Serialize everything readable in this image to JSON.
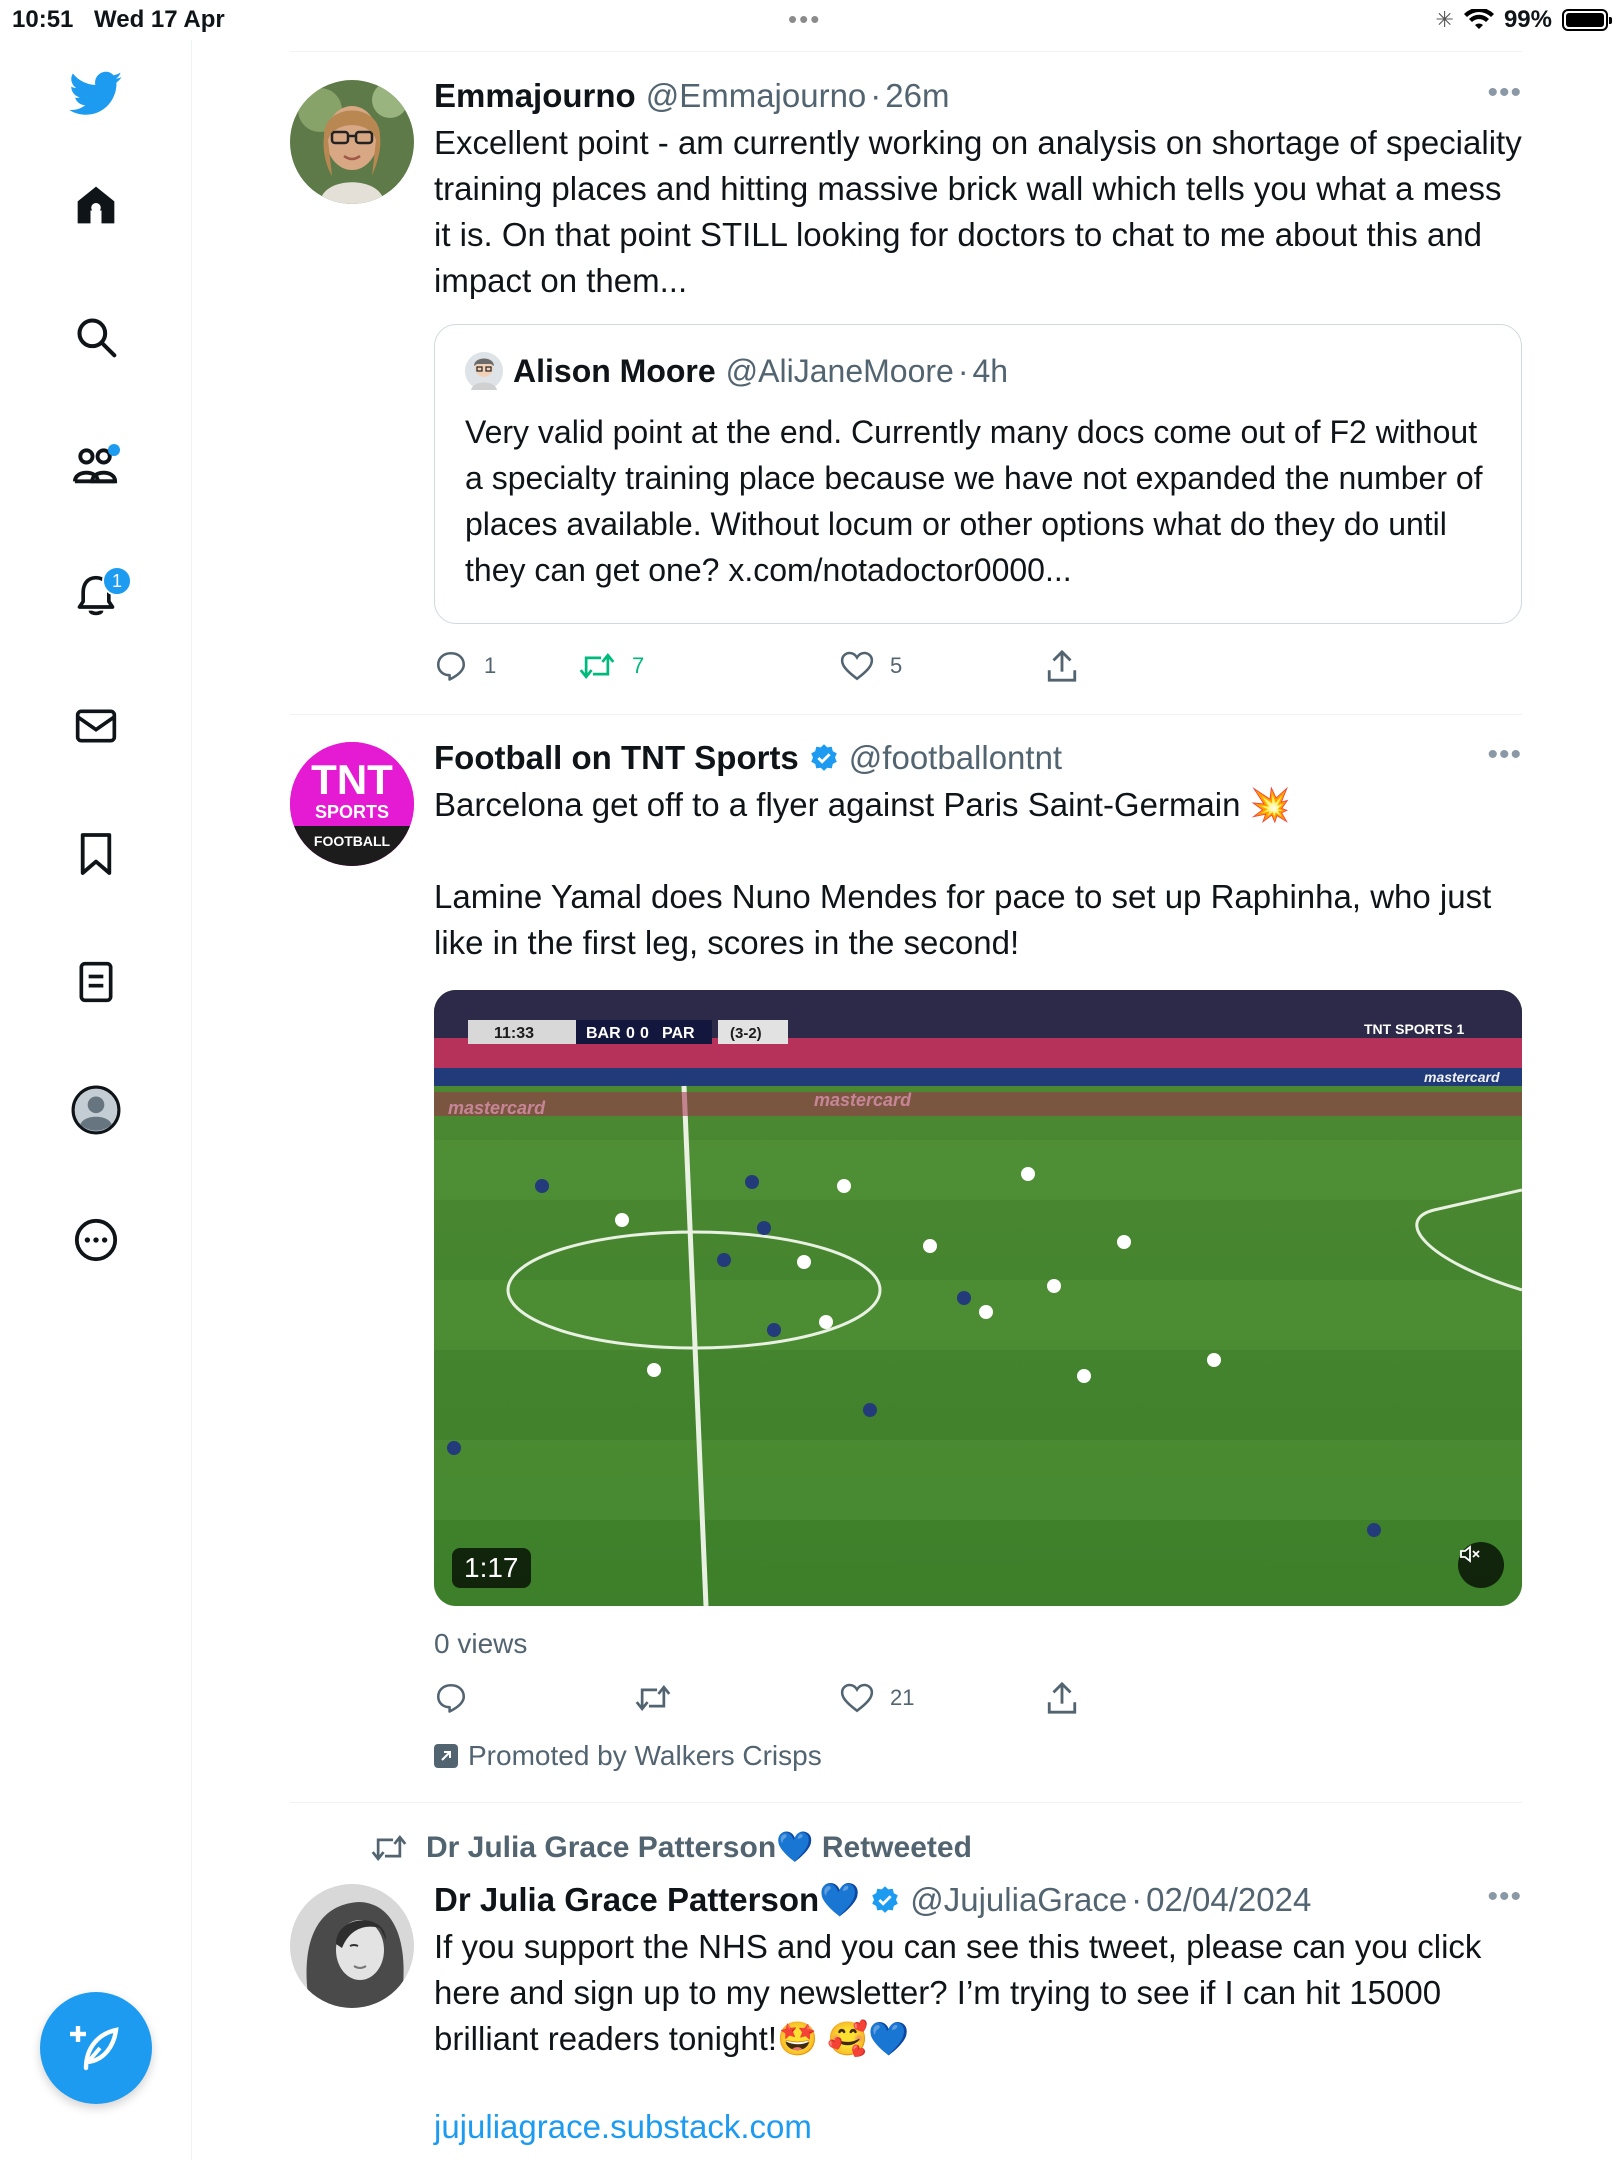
{
  "status_bar": {
    "time": "10:51",
    "date": "Wed 17 Apr",
    "battery": "99%"
  },
  "sidebar": {
    "items": [
      {
        "name": "home"
      },
      {
        "name": "explore"
      },
      {
        "name": "communities"
      },
      {
        "name": "notifications",
        "badge": "1"
      },
      {
        "name": "messages"
      },
      {
        "name": "bookmarks"
      },
      {
        "name": "lists"
      },
      {
        "name": "profile"
      },
      {
        "name": "more"
      }
    ]
  },
  "tweets": [
    {
      "name": "Emmajourno",
      "handle": "@Emmajourno",
      "time": "26m",
      "text": "Excellent point - am currently working on analysis on shortage of speciality training places and hitting massive brick wall which tells you what a mess it is. On that point STILL looking for doctors to chat to me about this and impact on them...",
      "quote": {
        "name": "Alison Moore",
        "handle": "@AliJaneMoore",
        "time": "4h",
        "text": "Very valid point at the end. Currently many docs come out of F2 without a specialty training place because we have not expanded the number of places available. Without locum or other options what do they do until they can get one? x.com/notadoctor0000..."
      },
      "replies": "1",
      "retweets": "7",
      "likes": "5"
    },
    {
      "name": "Football on TNT Sports",
      "handle": "@footballontnt",
      "text_line1": "Barcelona get off to a flyer against Paris Saint-Germain 💥",
      "text_line2": "Lamine Yamal does Nuno Mendes for pace to set up Raphinha, who just like in the first leg, scores in the second!",
      "avatar_text": {
        "top": "TNT",
        "mid": "SPORTS",
        "bottom": "FOOTBALL"
      },
      "video": {
        "duration": "1:17",
        "clock": "11:33",
        "home": "BAR",
        "home_score": "0",
        "away": "PAR",
        "away_score": "0",
        "aggregate": "(3-2)",
        "channel": "TNT SPORTS 1",
        "ad_board": "mastercard"
      },
      "views": "0 views",
      "likes": "21",
      "promoted": "Promoted by Walkers Crisps"
    },
    {
      "retweeted_by": "Dr Julia Grace Patterson💙",
      "retweeted_label": "Retweeted",
      "name": "Dr Julia Grace Patterson💙",
      "handle": "@JujuliaGrace",
      "time": "02/04/2024",
      "text": "If you support the NHS and you can see this tweet, please can you click here and sign up to my newsletter? I’m trying to see if I can hit 15000 brilliant readers tonight!🤩 🥰💙",
      "link": "jujuliagrace.substack.com"
    }
  ],
  "colors": {
    "accent": "#1d9bf0",
    "retweet_green": "#00ba7c",
    "muted": "#536471",
    "tnt_pink": "#e51bd4"
  }
}
